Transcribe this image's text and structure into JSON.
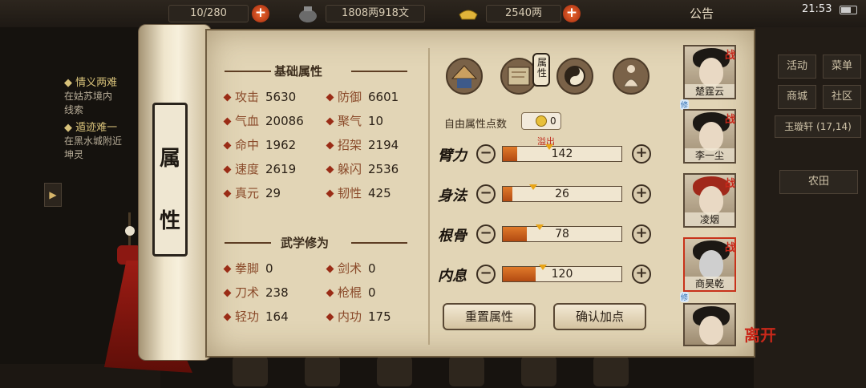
{
  "topbar": {
    "capacity_text": "10/280",
    "currency": "1808两918文",
    "silver": "2540两",
    "notice_label": "公告",
    "clock": "21:53"
  },
  "quests": [
    {
      "title": "情义两难",
      "desc": "在姑苏境内",
      "desc2": "线索"
    },
    {
      "title": "遁迹难一",
      "desc": "在黑水城附近",
      "desc2": "坤灵"
    }
  ],
  "right_menu": {
    "buttons": [
      "活动",
      "菜单",
      "商城",
      "社区"
    ],
    "location": "玉璇轩",
    "coords": "(17,14)",
    "farm": "农田"
  },
  "scroll": {
    "label_chars": [
      "属",
      "性"
    ]
  },
  "base_section": {
    "title": "基础属性",
    "stats": [
      {
        "label": "攻击",
        "value": "5630"
      },
      {
        "label": "防御",
        "value": "6601"
      },
      {
        "label": "气血",
        "value": "20086"
      },
      {
        "label": "聚气",
        "value": "10"
      },
      {
        "label": "命中",
        "value": "1962"
      },
      {
        "label": "招架",
        "value": "2194"
      },
      {
        "label": "速度",
        "value": "2619"
      },
      {
        "label": "躲闪",
        "value": "2536"
      },
      {
        "label": "真元",
        "value": "29"
      },
      {
        "label": "韧性",
        "value": "425"
      }
    ]
  },
  "martial_section": {
    "title": "武学修为",
    "stats": [
      {
        "label": "拳脚",
        "value": "0"
      },
      {
        "label": "剑术",
        "value": "0"
      },
      {
        "label": "刀术",
        "value": "238"
      },
      {
        "label": "枪棍",
        "value": "0"
      },
      {
        "label": "轻功",
        "value": "164"
      },
      {
        "label": "内功",
        "value": "175"
      }
    ]
  },
  "tabs": [
    {
      "name": "bamboo-hat-icon"
    },
    {
      "name": "scroll-map-icon"
    },
    {
      "name": "attribute-tab",
      "text": "属性"
    },
    {
      "name": "yin-yang-icon"
    },
    {
      "name": "meditation-figure-icon"
    }
  ],
  "attributes": {
    "free_points_label": "自由属性点数",
    "free_points": "0",
    "overflow_label": "溢出",
    "rows": [
      {
        "name": "臂力",
        "value": "142",
        "fill": 0.12
      },
      {
        "name": "身法",
        "value": "26",
        "fill": 0.08
      },
      {
        "name": "根骨",
        "value": "78",
        "fill": 0.2
      },
      {
        "name": "内息",
        "value": "120",
        "fill": 0.28
      }
    ],
    "reset_label": "重置属性",
    "confirm_label": "确认加点"
  },
  "party": [
    {
      "name": "楚霆云",
      "tag": "战",
      "badge": "修"
    },
    {
      "name": "李一尘",
      "tag": "战"
    },
    {
      "name": "凌烟",
      "tag": "战"
    },
    {
      "name": "商昊乾",
      "tag": "战",
      "badge": "修"
    },
    {
      "name": ""
    }
  ],
  "leave_label": "离开"
}
